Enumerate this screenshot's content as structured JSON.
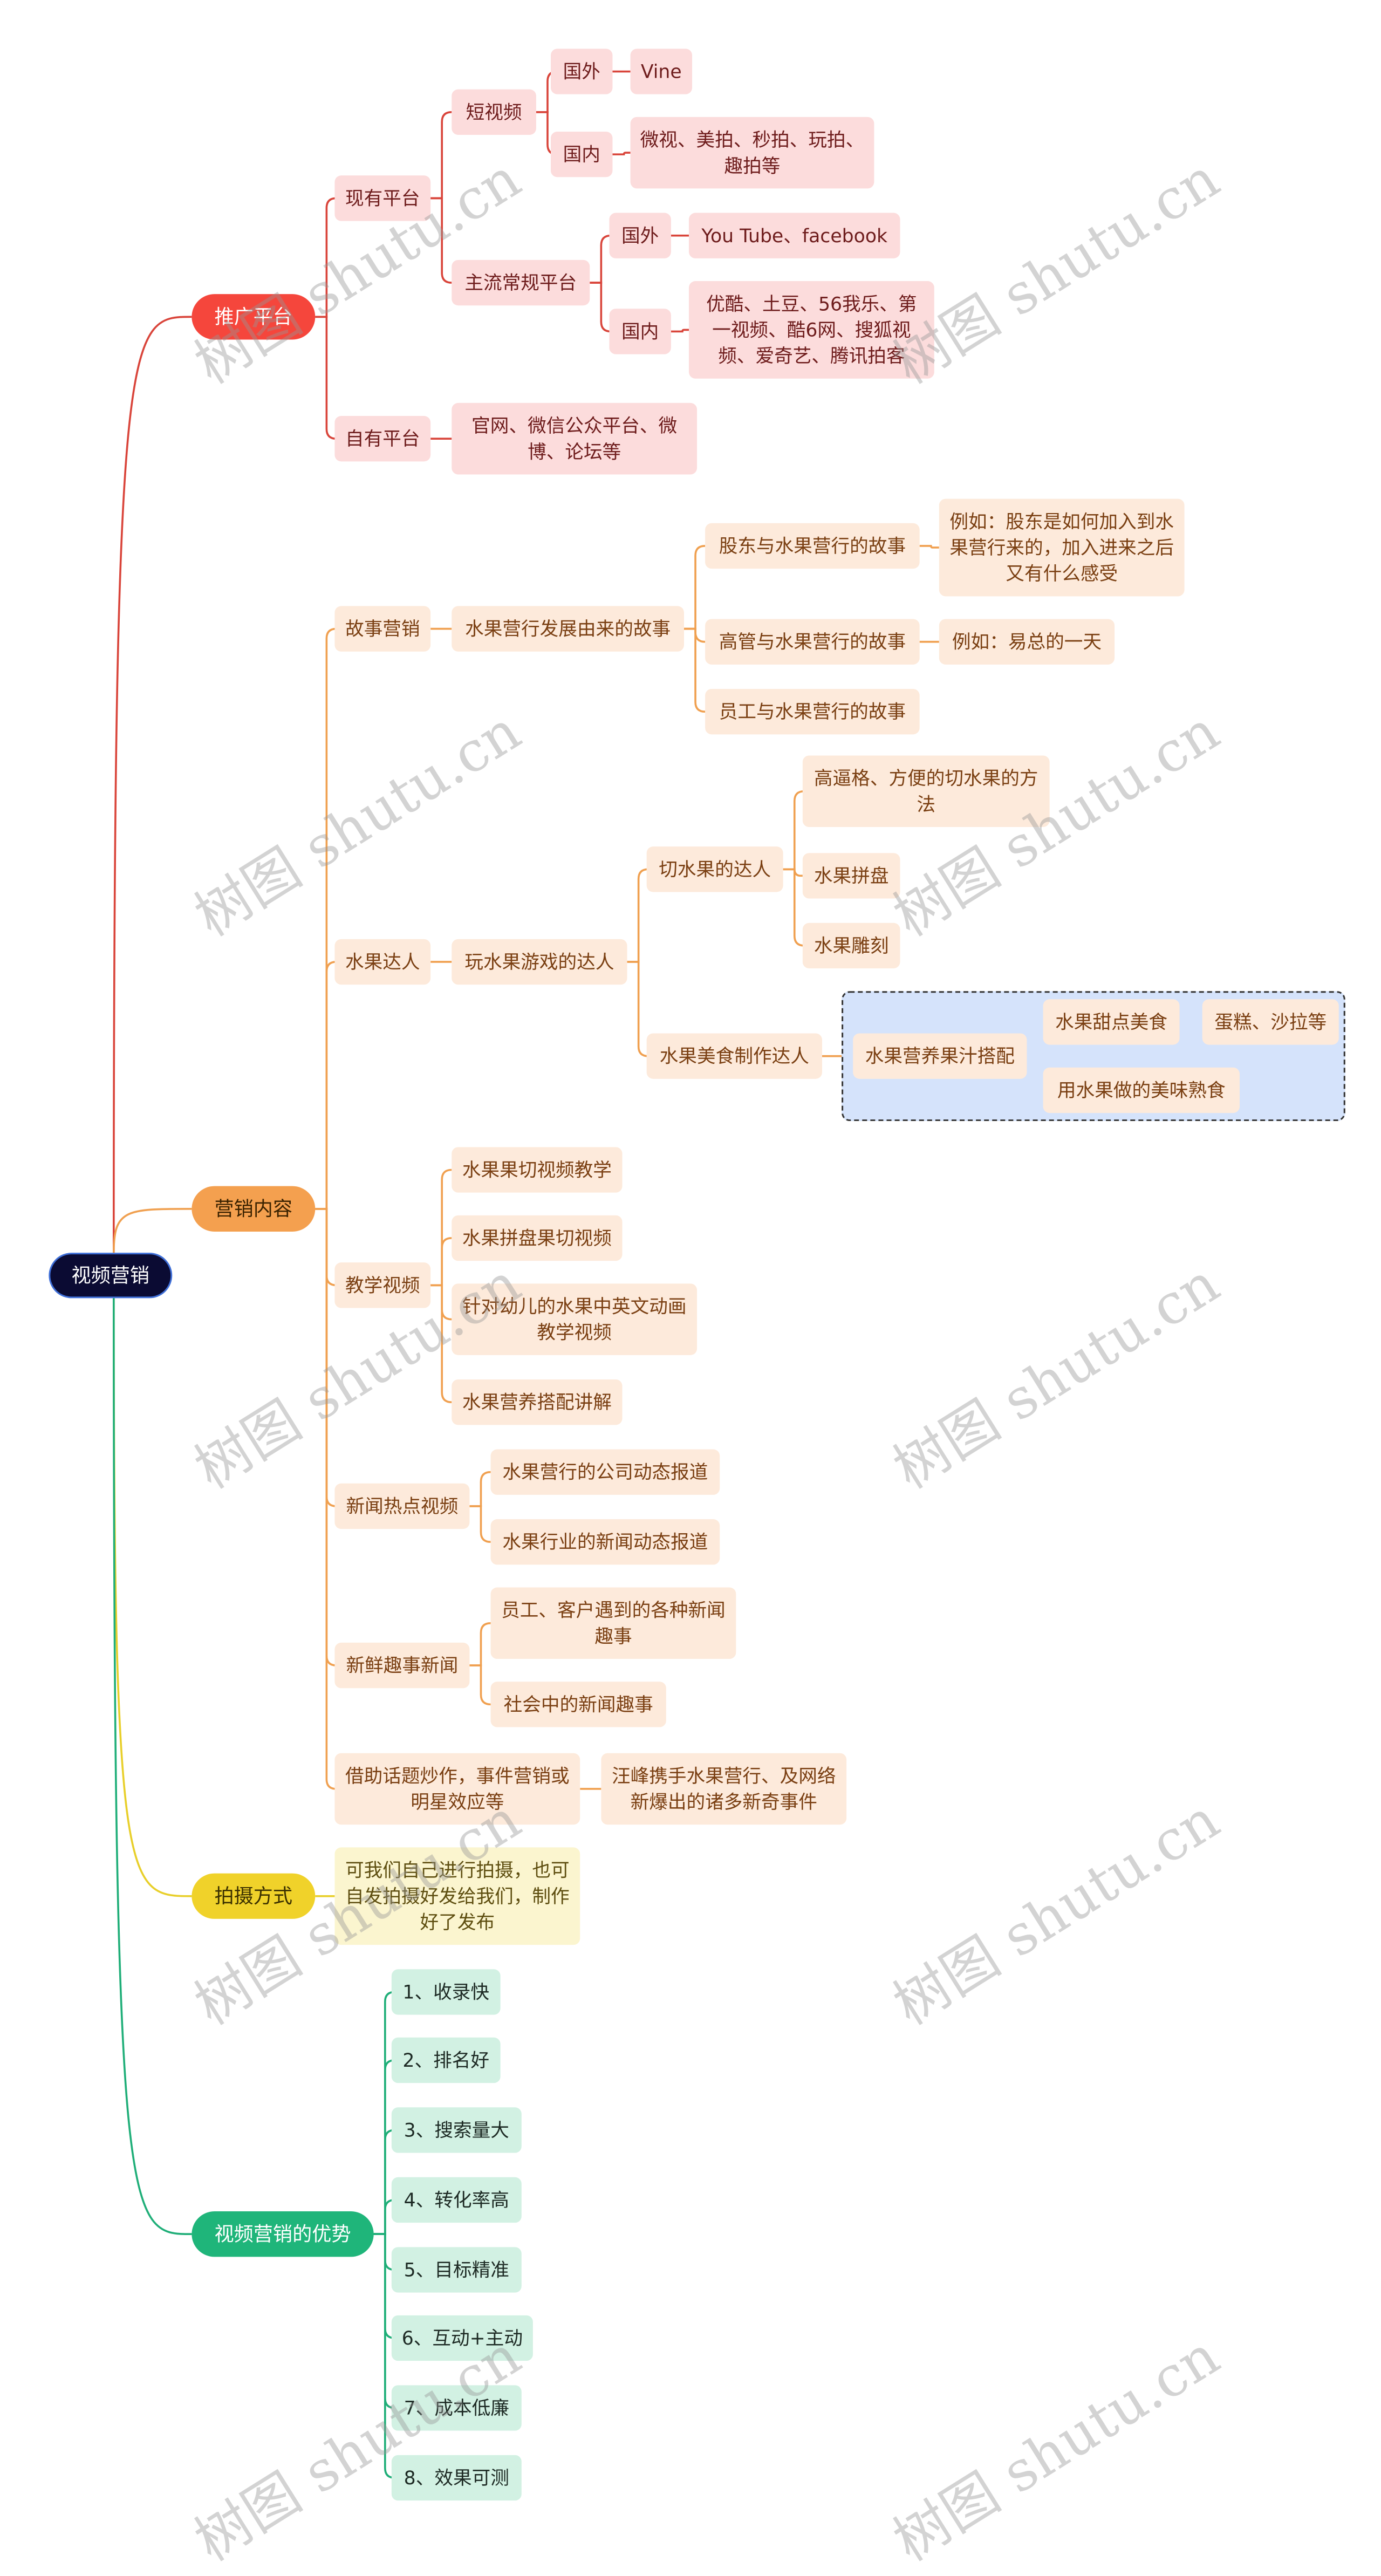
{
  "root": "视频营销",
  "watermark": "树图 shutu.cn",
  "colors": {
    "promotion": "#f5463c",
    "content": "#f4a04f",
    "shooting": "#f0d22a",
    "advantages": "#1fb57a",
    "root": "#0b0b33",
    "group_box": "#d5e3fb"
  },
  "promotion": {
    "label": "推广平台",
    "existing": "现有平台",
    "short_video": "短视频",
    "sv_foreign": "国外",
    "sv_foreign_items": "Vine",
    "sv_domestic": "国内",
    "sv_domestic_items": "微视、美拍、秒拍、玩拍、趣拍等",
    "mainstream": "主流常规平台",
    "ms_foreign": "国外",
    "ms_foreign_items": "You Tube、facebook",
    "ms_domestic": "国内",
    "ms_domestic_items": "优酷、土豆、56我乐、第一视频、酷6网、搜狐视频、爱奇艺、腾讯拍客",
    "own": "自有平台",
    "own_items": "官网、微信公众平台、微博、论坛等"
  },
  "content": {
    "label": "营销内容",
    "story": "故事营销",
    "story_origin": "水果营行发展由来的故事",
    "shareholder": "股东与水果营行的故事",
    "shareholder_example": "例如：股东是如何加入到水果营行来的，加入进来之后又有什么感受",
    "executive": "高管与水果营行的故事",
    "executive_example": "例如：易总的一天",
    "employee": "员工与水果营行的故事",
    "expert": "水果达人",
    "game_expert": "玩水果游戏的达人",
    "cutting_expert": "切水果的达人",
    "cutting_method": "高逼格、方便的切水果的方法",
    "platter": "水果拼盘",
    "carving": "水果雕刻",
    "food_expert": "水果美食制作达人",
    "juice": "水果营养果汁搭配",
    "dessert": "水果甜点美食",
    "dessert_items": "蛋糕、沙拉等",
    "cooked": "用水果做的美味熟食",
    "teaching": "教学视频",
    "teach_1": "水果果切视频教学",
    "teach_2": "水果拼盘果切视频",
    "teach_3": "针对幼儿的水果中英文动画教学视频",
    "teach_4": "水果营养搭配讲解",
    "news": "新闻热点视频",
    "news_1": "水果营行的公司动态报道",
    "news_2": "水果行业的新闻动态报道",
    "fun": "新鲜趣事新闻",
    "fun_1": "员工、客户遇到的各种新闻趣事",
    "fun_2": "社会中的新闻趣事",
    "hype": "借助话题炒作，事件营销或明星效应等",
    "hype_example": "汪峰携手水果营行、及网络新爆出的诸多新奇事件"
  },
  "shooting": {
    "label": "拍摄方式",
    "detail": "可我们自己进行拍摄，也可自发拍摄好发给我们，制作好了发布"
  },
  "advantages": {
    "label": "视频营销的优势",
    "items": [
      "1、收录快",
      "2、排名好",
      "3、搜索量大",
      "4、转化率高",
      "5、目标精准",
      "6、互动+主动",
      "7、成本低廉",
      "8、效果可测"
    ]
  }
}
